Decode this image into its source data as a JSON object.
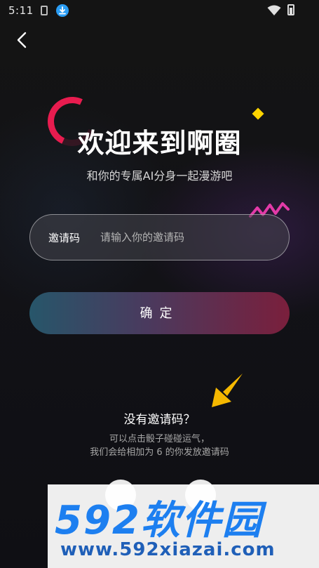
{
  "status_bar": {
    "time": "5:11"
  },
  "header": {
    "back_icon": "chevron-left-icon"
  },
  "hero": {
    "title": "欢迎来到啊圈",
    "subtitle": "和你的专属AI分身一起漫游吧"
  },
  "invite": {
    "label": "邀请码",
    "placeholder": "请输入你的邀请码",
    "value": ""
  },
  "confirm": {
    "label": "确定"
  },
  "no_code": {
    "title": "没有邀请码？",
    "hint_line1": "可以点击骰子碰碰运气，",
    "hint_line2": "我们会给相加为 6 的你发放邀请码"
  },
  "watermark": {
    "logo_text": "592软件园",
    "url": "www.592xiazai.com"
  },
  "colors": {
    "accent_red": "#e81c4f",
    "accent_yellow": "#ffd400",
    "button_gradient_start": "#27566a",
    "button_gradient_end": "#7a1f3c",
    "watermark_blue": "#1d7ff0"
  }
}
